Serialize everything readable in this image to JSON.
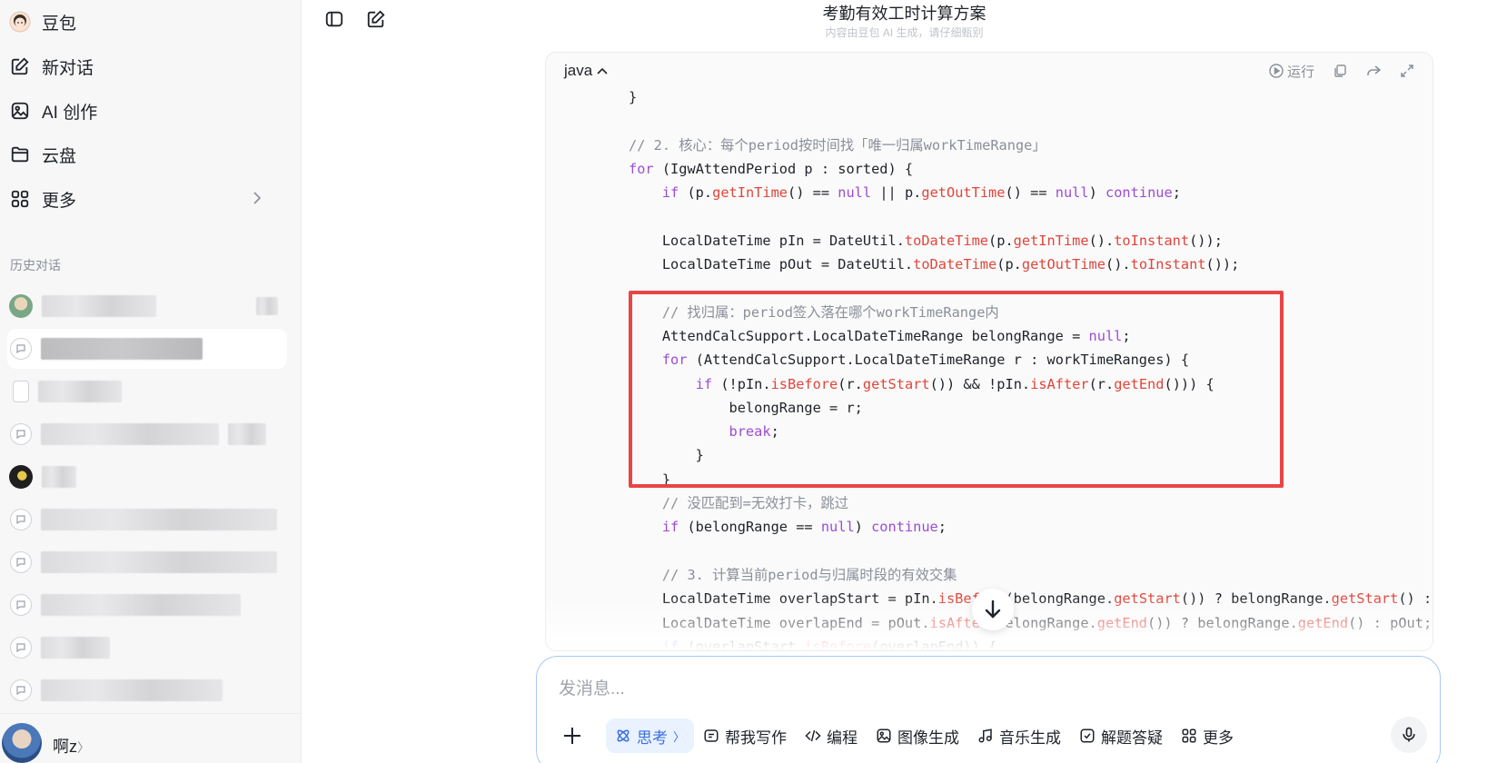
{
  "sidebar": {
    "nav": [
      {
        "label": "豆包",
        "icon": "doubao-avatar-icon"
      },
      {
        "label": "新对话",
        "icon": "edit-icon"
      },
      {
        "label": "AI 创作",
        "icon": "image-icon"
      },
      {
        "label": "云盘",
        "icon": "folder-icon"
      },
      {
        "label": "更多",
        "icon": "grid-icon"
      }
    ],
    "history_title": "历史对话",
    "user": {
      "name": "啊z",
      "chevron": "〉"
    }
  },
  "header": {
    "title": "考勤有效工时计算方案",
    "subtitle": "内容由豆包 AI 生成，请仔细甄别"
  },
  "code_block": {
    "language": "java",
    "run_label": "运行",
    "highlight_color": "#e84545"
  },
  "composer": {
    "placeholder": "发消息...",
    "tools": [
      {
        "label": "思考",
        "suffix": "〉",
        "icon": "atom-icon",
        "active": true
      },
      {
        "label": "帮我写作",
        "icon": "write-icon"
      },
      {
        "label": "编程",
        "icon": "code-icon"
      },
      {
        "label": "图像生成",
        "icon": "image-icon"
      },
      {
        "label": "音乐生成",
        "icon": "music-icon"
      },
      {
        "label": "解题答疑",
        "icon": "check-icon"
      },
      {
        "label": "更多",
        "icon": "grid-icon"
      }
    ]
  },
  "colors": {
    "accent": "#3b6fe0",
    "keyword": "#9b4dd4",
    "method": "#e0453a",
    "comment": "#8a8f99"
  }
}
